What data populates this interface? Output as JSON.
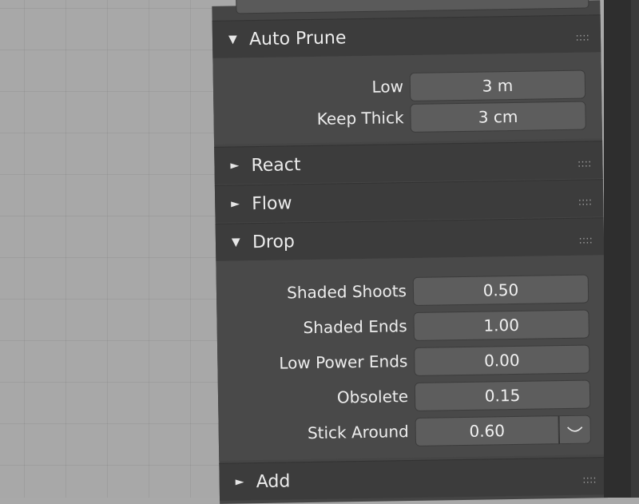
{
  "sections": {
    "auto_prune": {
      "title": "Auto Prune",
      "arrow": "▼",
      "expanded": true
    },
    "react": {
      "title": "React",
      "arrow": "►",
      "expanded": false
    },
    "flow": {
      "title": "Flow",
      "arrow": "►",
      "expanded": false
    },
    "drop": {
      "title": "Drop",
      "arrow": "▼",
      "expanded": true
    },
    "add": {
      "title": "Add",
      "arrow": "►",
      "expanded": false
    }
  },
  "grip": "::::",
  "auto_prune_fields": [
    {
      "label": "Low",
      "value": "3 m"
    },
    {
      "label": "Keep Thick",
      "value": "3 cm"
    }
  ],
  "drop_fields": [
    {
      "label": "Shaded Shoots",
      "value": "0.50"
    },
    {
      "label": "Shaded Ends",
      "value": "1.00"
    },
    {
      "label": "Low Power Ends",
      "value": "0.00"
    },
    {
      "label": "Obsolete",
      "value": "0.15"
    },
    {
      "label": "Stick Around",
      "value": "0.60",
      "dropdown_icon": "chevron-down"
    }
  ],
  "colors": {
    "panel_bg": "#454545",
    "header_bg": "#3c3c3c",
    "field_bg": "#5d5d5d",
    "viewport_bg": "#a8a8a8"
  }
}
